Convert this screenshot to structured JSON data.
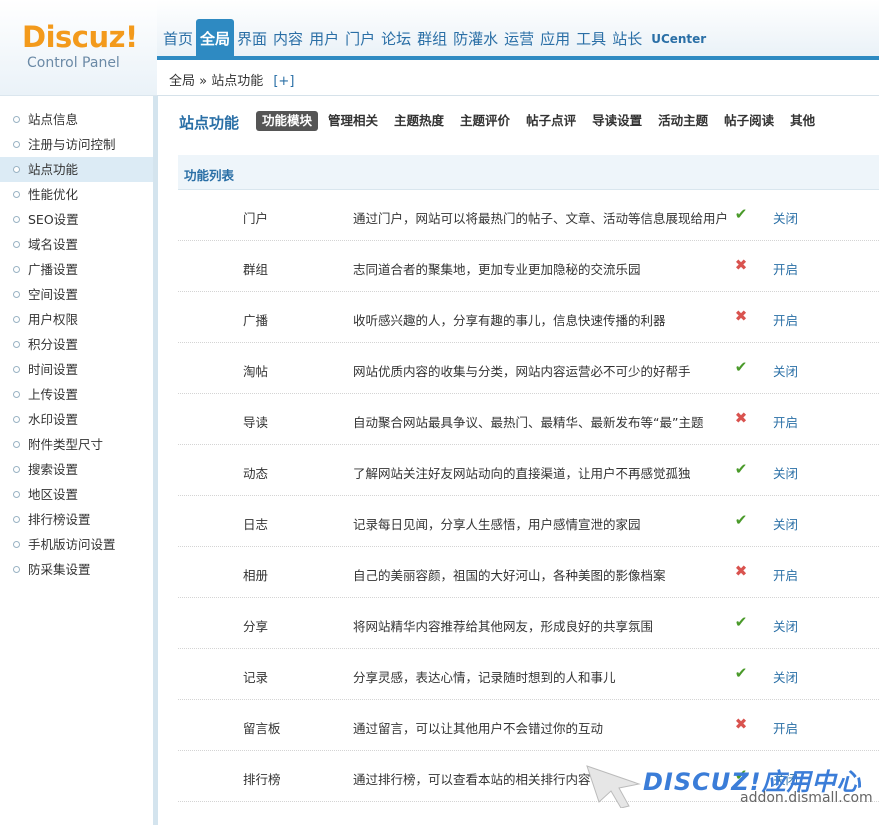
{
  "logo": {
    "main": "Discuz!",
    "sub": "Control Panel"
  },
  "topnav": {
    "items": [
      {
        "label": "首页",
        "active": false
      },
      {
        "label": "全局",
        "active": true
      },
      {
        "label": "界面",
        "active": false
      },
      {
        "label": "内容",
        "active": false
      },
      {
        "label": "用户",
        "active": false
      },
      {
        "label": "门户",
        "active": false
      },
      {
        "label": "论坛",
        "active": false
      },
      {
        "label": "群组",
        "active": false
      },
      {
        "label": "防灌水",
        "active": false
      },
      {
        "label": "运营",
        "active": false
      },
      {
        "label": "应用",
        "active": false
      },
      {
        "label": "工具",
        "active": false
      },
      {
        "label": "站长",
        "active": false
      },
      {
        "label": "UCenter",
        "active": false
      }
    ]
  },
  "breadcrumb": {
    "text": "全局 » 站点功能",
    "add": "[+]"
  },
  "sidebar": {
    "items": [
      {
        "label": "站点信息"
      },
      {
        "label": "注册与访问控制"
      },
      {
        "label": "站点功能",
        "active": true
      },
      {
        "label": "性能优化"
      },
      {
        "label": "SEO设置"
      },
      {
        "label": "域名设置"
      },
      {
        "label": "广播设置"
      },
      {
        "label": "空间设置"
      },
      {
        "label": "用户权限"
      },
      {
        "label": "积分设置"
      },
      {
        "label": "时间设置"
      },
      {
        "label": "上传设置"
      },
      {
        "label": "水印设置"
      },
      {
        "label": "附件类型尺寸"
      },
      {
        "label": "搜索设置"
      },
      {
        "label": "地区设置"
      },
      {
        "label": "排行榜设置"
      },
      {
        "label": "手机版访问设置"
      },
      {
        "label": "防采集设置"
      }
    ]
  },
  "main": {
    "title": "站点功能",
    "tabs": [
      {
        "label": "功能模块",
        "active": true
      },
      {
        "label": "管理相关"
      },
      {
        "label": "主题热度"
      },
      {
        "label": "主题评价"
      },
      {
        "label": "帖子点评"
      },
      {
        "label": "导读设置"
      },
      {
        "label": "活动主题"
      },
      {
        "label": "帖子阅读"
      },
      {
        "label": "其他"
      }
    ],
    "list_header": "功能列表",
    "rows": [
      {
        "name": "门户",
        "desc": "通过门户，网站可以将最热门的帖子、文章、活动等信息展现给用户",
        "enabled": true,
        "action": "关闭"
      },
      {
        "name": "群组",
        "desc": "志同道合者的聚集地，更加专业更加隐秘的交流乐园",
        "enabled": false,
        "action": "开启"
      },
      {
        "name": "广播",
        "desc": "收听感兴趣的人，分享有趣的事儿，信息快速传播的利器",
        "enabled": false,
        "action": "开启"
      },
      {
        "name": "淘帖",
        "desc": "网站优质内容的收集与分类，网站内容运营必不可少的好帮手",
        "enabled": true,
        "action": "关闭"
      },
      {
        "name": "导读",
        "desc": "自动聚合网站最具争议、最热门、最精华、最新发布等“最”主题",
        "enabled": false,
        "action": "开启"
      },
      {
        "name": "动态",
        "desc": "了解网站关注好友网站动向的直接渠道，让用户不再感觉孤独",
        "enabled": true,
        "action": "关闭"
      },
      {
        "name": "日志",
        "desc": "记录每日见闻，分享人生感悟，用户感情宣泄的家园",
        "enabled": true,
        "action": "关闭"
      },
      {
        "name": "相册",
        "desc": "自己的美丽容颜，祖国的大好河山，各种美图的影像档案",
        "enabled": false,
        "action": "开启"
      },
      {
        "name": "分享",
        "desc": "将网站精华内容推荐给其他网友，形成良好的共享氛围",
        "enabled": true,
        "action": "关闭"
      },
      {
        "name": "记录",
        "desc": "分享灵感，表达心情，记录随时想到的人和事儿",
        "enabled": true,
        "action": "关闭"
      },
      {
        "name": "留言板",
        "desc": "通过留言，可以让其他用户不会错过你的互动",
        "enabled": false,
        "action": "开启"
      },
      {
        "name": "排行榜",
        "desc": "通过排行榜，可以查看本站的相关排行内容",
        "enabled": true,
        "action": "关闭"
      }
    ]
  },
  "watermark": {
    "title": "DISCUZ!应用中心",
    "url": "addon.dismall.com"
  },
  "colors": {
    "accent": "#2e8ac2",
    "enabled": "#4a9a2a",
    "disabled": "#d9534f",
    "logo": "#f39a1c"
  }
}
